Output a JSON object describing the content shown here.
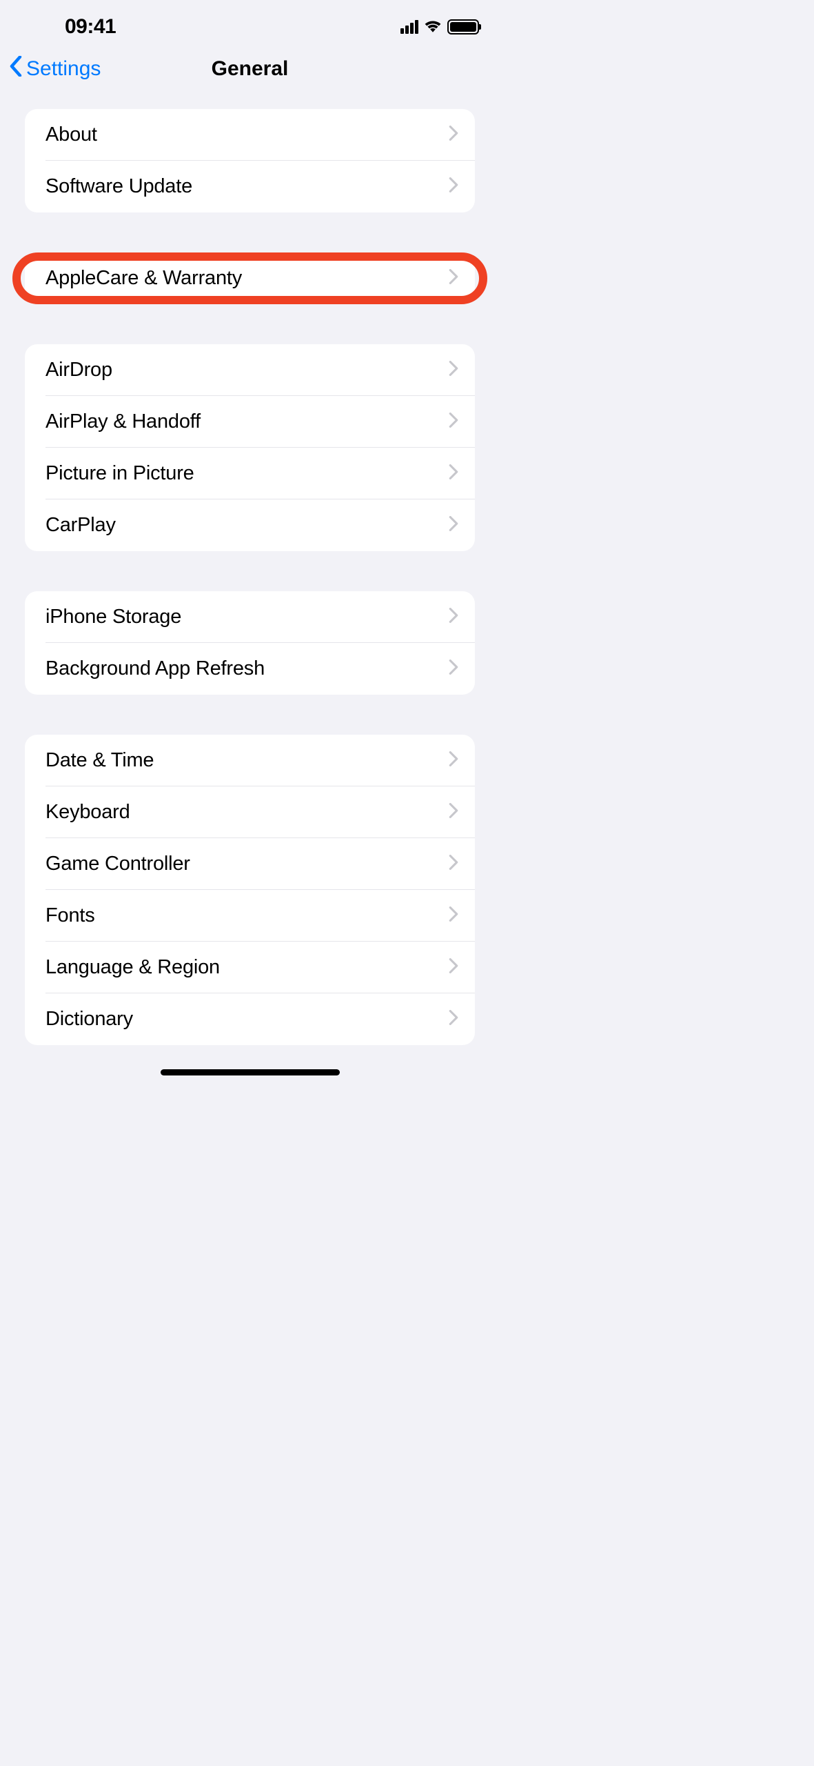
{
  "status": {
    "time": "09:41"
  },
  "nav": {
    "back_label": "Settings",
    "title": "General"
  },
  "groups": {
    "g0": [
      {
        "label": "About"
      },
      {
        "label": "Software Update"
      }
    ],
    "g1": [
      {
        "label": "AppleCare & Warranty"
      }
    ],
    "g2": [
      {
        "label": "AirDrop"
      },
      {
        "label": "AirPlay & Handoff"
      },
      {
        "label": "Picture in Picture"
      },
      {
        "label": "CarPlay"
      }
    ],
    "g3": [
      {
        "label": "iPhone Storage"
      },
      {
        "label": "Background App Refresh"
      }
    ],
    "g4": [
      {
        "label": "Date & Time"
      },
      {
        "label": "Keyboard"
      },
      {
        "label": "Game Controller"
      },
      {
        "label": "Fonts"
      },
      {
        "label": "Language & Region"
      },
      {
        "label": "Dictionary"
      }
    ]
  }
}
